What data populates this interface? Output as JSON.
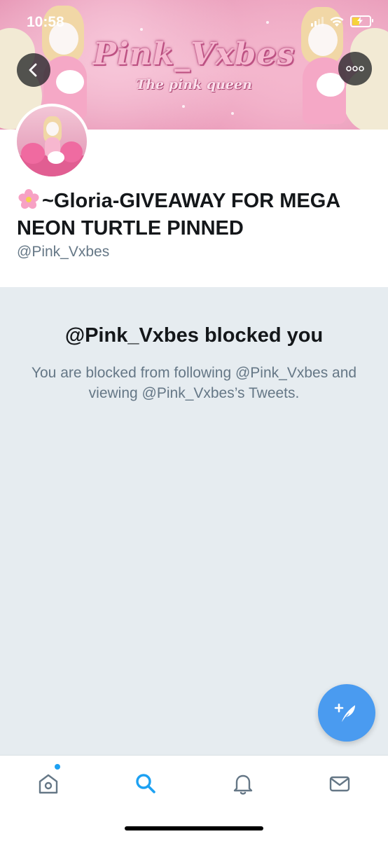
{
  "status_bar": {
    "time": "10:58"
  },
  "banner": {
    "title": "Pink_Vxbes",
    "subtitle": "The pink queen"
  },
  "profile": {
    "display_name_emoji": "cherry-blossom-emoji",
    "display_name": "~Gloria-GIVEAWAY FOR MEGA NEON TURTLE PINNED",
    "handle": "@Pink_Vxbes"
  },
  "blocked": {
    "title": "@Pink_Vxbes blocked you",
    "message": "You are blocked from following @Pink_Vxbes and viewing @Pink_Vxbes’s Tweets."
  },
  "icons": {
    "back": "chevron-left-icon",
    "more": "more-icon",
    "compose": "compose-tweet-icon",
    "home": "home-icon",
    "search": "search-icon",
    "notifications": "bell-icon",
    "messages": "envelope-icon"
  },
  "colors": {
    "accent": "#1da1f2",
    "fab": "#4a9bf0",
    "panel_background": "#e6ecf0",
    "secondary_text": "#657786",
    "primary_text": "#14171a"
  },
  "tab_bar": {
    "active_tab": "search",
    "home_has_new_content": true
  }
}
